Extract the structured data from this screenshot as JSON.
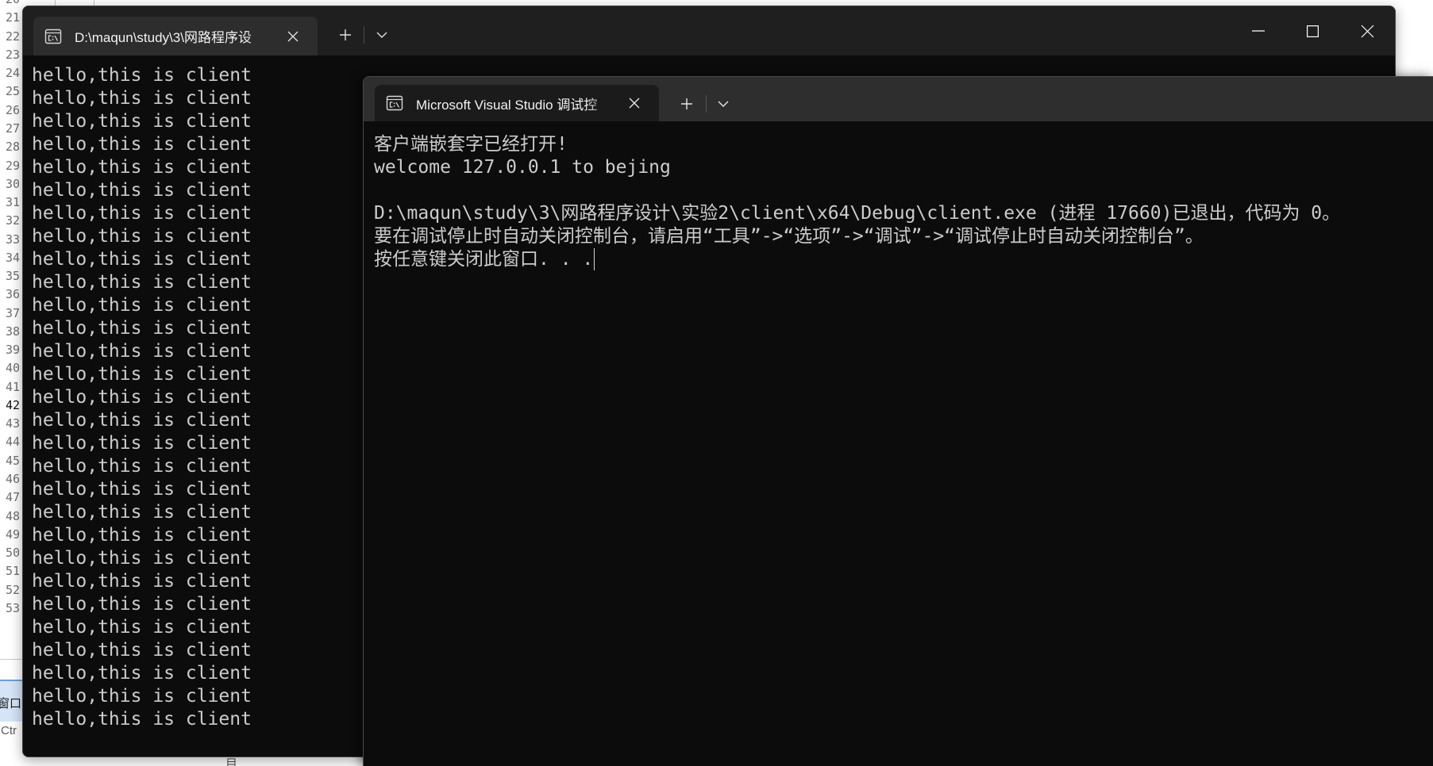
{
  "editor": {
    "line_numbers": [
      {
        "number": "20"
      },
      {
        "number": "21"
      },
      {
        "number": "22"
      },
      {
        "number": "23"
      },
      {
        "number": "24"
      },
      {
        "number": "25"
      },
      {
        "number": "26"
      },
      {
        "number": "27"
      },
      {
        "number": "28"
      },
      {
        "number": "29"
      },
      {
        "number": "30"
      },
      {
        "number": "31"
      },
      {
        "number": "32"
      },
      {
        "number": "33"
      },
      {
        "number": "34"
      },
      {
        "number": "35"
      },
      {
        "number": "36"
      },
      {
        "number": "37"
      },
      {
        "number": "38"
      },
      {
        "number": "39"
      },
      {
        "number": "40"
      },
      {
        "number": "41"
      },
      {
        "number": "42",
        "current": true
      },
      {
        "number": "43"
      },
      {
        "number": "44"
      },
      {
        "number": "45"
      },
      {
        "number": "46"
      },
      {
        "number": "47"
      },
      {
        "number": "48"
      },
      {
        "number": "49"
      },
      {
        "number": "50"
      },
      {
        "number": "51"
      },
      {
        "number": "52"
      },
      {
        "number": "53"
      }
    ],
    "bottom_panel_label": "窗口",
    "shortcut_fragment": "Ctr",
    "bottom_fragment": "目"
  },
  "back_window": {
    "tab_title": "D:\\maqun\\study\\3\\网路程序设",
    "output_lines": [
      "hello,this is client",
      "hello,this is client",
      "hello,this is client",
      "hello,this is client",
      "hello,this is client",
      "hello,this is client",
      "hello,this is client",
      "hello,this is client",
      "hello,this is client",
      "hello,this is client",
      "hello,this is client",
      "hello,this is client",
      "hello,this is client",
      "hello,this is client",
      "hello,this is client",
      "hello,this is client",
      "hello,this is client",
      "hello,this is client",
      "hello,this is client",
      "hello,this is client",
      "hello,this is client",
      "hello,this is client",
      "hello,this is client",
      "hello,this is client",
      "hello,this is client",
      "hello,this is client",
      "hello,this is client",
      "hello,this is client",
      "hello,this is client"
    ]
  },
  "front_window": {
    "tab_title": "Microsoft Visual Studio 调试控",
    "output_lines": [
      "客户端嵌套字已经打开!",
      "welcome 127.0.0.1 to bejing",
      "",
      "D:\\maqun\\study\\3\\网路程序设计\\实验2\\client\\x64\\Debug\\client.exe (进程 17660)已退出，代码为 0。",
      "要在调试停止时自动关闭控制台，请启用“工具”->“选项”->“调试”->“调试停止时自动关闭控制台”。",
      "按任意键关闭此窗口. . ."
    ]
  },
  "icons": {
    "tab": "console-icon",
    "tab_close": "close-icon",
    "new_tab": "plus-icon",
    "tab_dropdown": "chevron-down-icon",
    "minimize": "minimize-icon",
    "maximize": "maximize-icon",
    "close": "close-icon"
  },
  "colors": {
    "terminal_background": "#0c0c0c",
    "terminal_text": "#cccccc",
    "editor_background": "#ffffff",
    "line_number": "#6e6e6e",
    "current_line_number": "#111111"
  }
}
